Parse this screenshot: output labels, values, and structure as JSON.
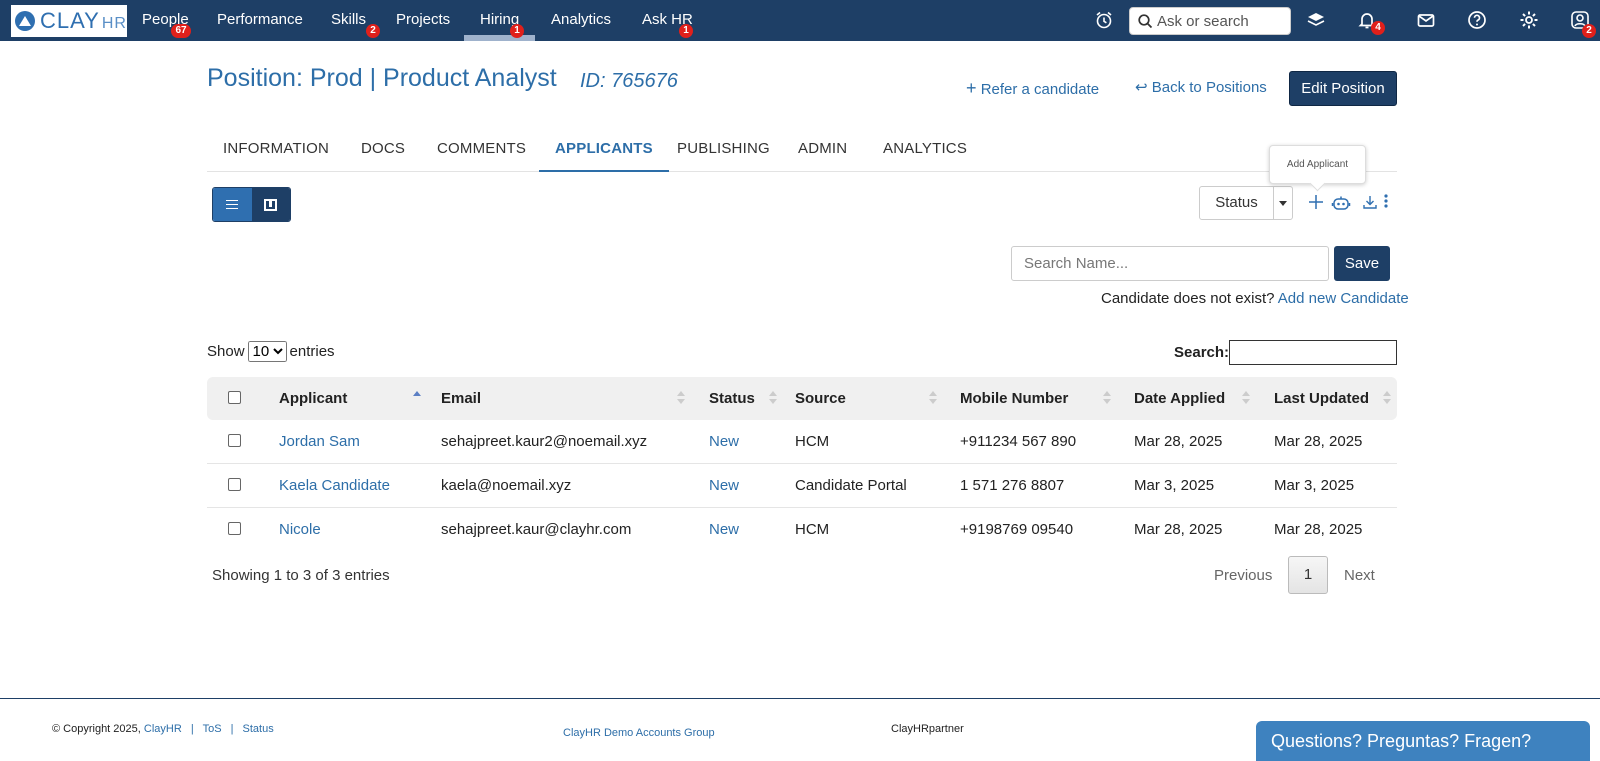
{
  "topnav": {
    "logo_text": "CLAY",
    "logo_suffix": "HR",
    "items": [
      {
        "label": "People",
        "badge": "67"
      },
      {
        "label": "Performance",
        "badge": ""
      },
      {
        "label": "Skills",
        "badge": "2"
      },
      {
        "label": "Projects",
        "badge": ""
      },
      {
        "label": "Hiring",
        "badge": "1"
      },
      {
        "label": "Analytics",
        "badge": ""
      },
      {
        "label": "Ask HR",
        "badge": "1"
      }
    ],
    "search_placeholder": "Ask or search",
    "notifications_badge": "4",
    "profile_badge": "2",
    "bg_color": "#1e3f66"
  },
  "header": {
    "title": "Position: Prod | Product Analyst",
    "id": "ID: 765676",
    "refer_label": "Refer a candidate",
    "back_label": "Back to Positions",
    "edit_label": "Edit Position"
  },
  "tabs": [
    "INFORMATION",
    "DOCS",
    "COMMENTS",
    "APPLICANTS",
    "PUBLISHING",
    "ADMIN",
    "ANALYTICS"
  ],
  "toolbar": {
    "status_label": "Status",
    "tooltip": "Add Applicant"
  },
  "add_applicant": {
    "search_placeholder": "Search Name...",
    "save_label": "Save",
    "note": "Candidate does not exist?",
    "add_link": "Add new Candidate"
  },
  "table_controls": {
    "show_label": "Show",
    "entries_value": "10",
    "entries_label": "entries",
    "search_label": "Search:"
  },
  "table": {
    "columns": [
      "Applicant",
      "Email",
      "Status",
      "Source",
      "Mobile Number",
      "Date Applied",
      "Last Updated"
    ],
    "rows": [
      [
        "Jordan Sam",
        "sehajpreet.kaur2@noemail.xyz",
        "New",
        "HCM",
        "+911234 567 890",
        "Mar 28, 2025",
        "Mar 28, 2025"
      ],
      [
        "Kaela Candidate",
        "kaela@noemail.xyz",
        "New",
        "Candidate Portal",
        "1 571 276 8807",
        "Mar 3, 2025",
        "Mar 3, 2025"
      ],
      [
        "Nicole",
        "sehajpreet.kaur@clayhr.com",
        "New",
        "HCM",
        "+9198769 09540",
        "Mar 28, 2025",
        "Mar 28, 2025"
      ]
    ],
    "info": "Showing 1 to 3 of 3 entries",
    "prev": "Previous",
    "page": "1",
    "next": "Next"
  },
  "footer": {
    "copyright": "© Copyright 2025,",
    "clayhr": "ClayHR",
    "tos": "ToS",
    "status": "Status",
    "group": "ClayHR Demo Accounts Group",
    "partner": "ClayHRpartner",
    "chat": "Questions? Preguntas? Fragen?"
  }
}
